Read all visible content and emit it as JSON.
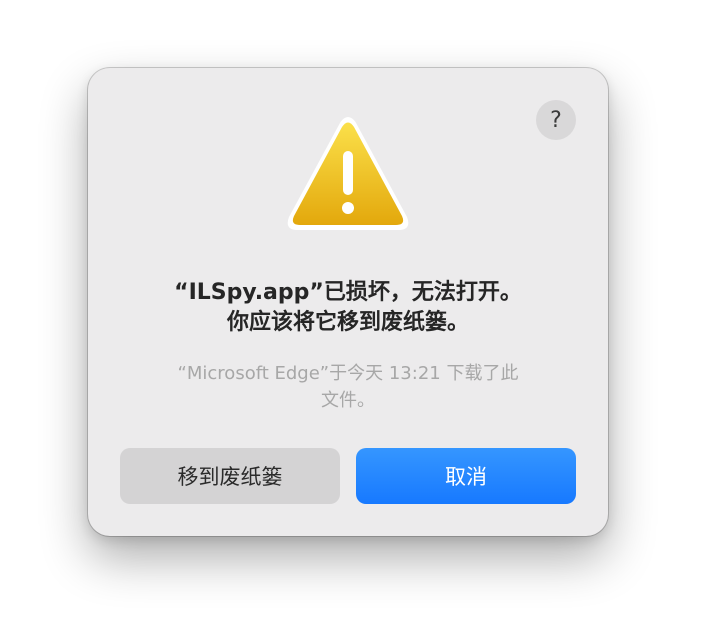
{
  "dialog": {
    "help_label": "?",
    "title_line1": "“ILSpy.app”已损坏，无法打开。",
    "title_line2": "你应该将它移到废纸篓。",
    "message_line1": "“Microsoft Edge”于今天 13:21 下载了此",
    "message_line2": "文件。",
    "move_to_trash_label": "移到废纸篓",
    "cancel_label": "取消"
  },
  "icons": {
    "warning": "warning-triangle-icon",
    "help": "question-mark-icon"
  },
  "colors": {
    "dialog_background": "#ecebec",
    "primary_button": "#1779ff",
    "secondary_button": "#d4d3d4",
    "warning_yellow": "#f2c41e"
  }
}
